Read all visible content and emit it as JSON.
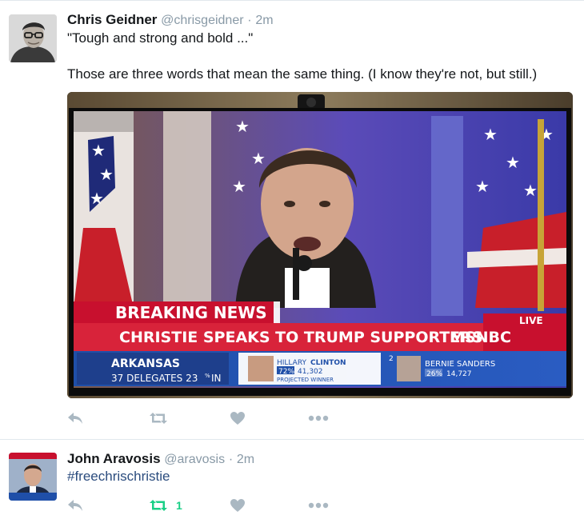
{
  "tweets": [
    {
      "name": "Chris Geidner",
      "handle": "@chrisgeidner",
      "separator": "·",
      "time": "2m",
      "text_lines": [
        "\"Tough and strong and bold ...\"",
        "Those are three words that mean the same thing. (I know they're not, but still.)"
      ],
      "media": {
        "breaking": "BREAKING NEWS",
        "headline": "CHRISTIE SPEAKS TO TRUMP SUPPORTERS",
        "live": "LIVE",
        "network": "MSNBC",
        "state": "ARKANSAS",
        "delegates": "37 DELEGATES 23",
        "delegates_pct": "%",
        "delegates_in": "IN",
        "candidate1_first": "HILLARY",
        "candidate1_last": "CLINTON",
        "candidate1_pct": "72%",
        "candidate1_votes": "41,302",
        "candidate1_status": "PROJECTED WINNER",
        "rank": "2",
        "candidate2_name": "BERNIE SANDERS",
        "candidate2_pct": "26%",
        "candidate2_votes": "14,727"
      },
      "actions": {
        "reply_icon": "reply-icon",
        "retweet_icon": "retweet-icon",
        "like_icon": "heart-icon",
        "more_icon": "more-icon",
        "retweet_count": ""
      }
    },
    {
      "name": "John Aravosis",
      "handle": "@aravosis",
      "separator": "·",
      "time": "2m",
      "text_lines": [
        "#freechrischristie"
      ],
      "actions": {
        "reply_icon": "reply-icon",
        "retweet_icon": "retweet-icon",
        "like_icon": "heart-icon",
        "more_icon": "more-icon",
        "retweet_count": "1"
      }
    }
  ],
  "colors": {
    "retweet_active": "#19cf86",
    "action_gray": "#aab8c2",
    "breaking_red": "#c8102e",
    "ticker_blue": "#1f4fa8"
  }
}
